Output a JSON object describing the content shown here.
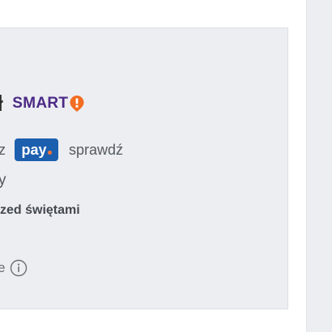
{
  "offer": {
    "price_tail": "ł",
    "smart_label": "SMART",
    "pay_prefix": "z",
    "pay_badge": "pay",
    "pay_check": "sprawdź",
    "line3": "y",
    "delivery": "zed świętami",
    "info_text": "e"
  },
  "colors": {
    "card_bg": "#eceef1",
    "smart_purple": "#4b2a86",
    "smart_orange": "#f36d22",
    "pay_blue": "#1c5fae",
    "pay_dot": "#f0743c"
  },
  "icons": {
    "smart": "smart-badge-icon",
    "info": "info-icon"
  }
}
